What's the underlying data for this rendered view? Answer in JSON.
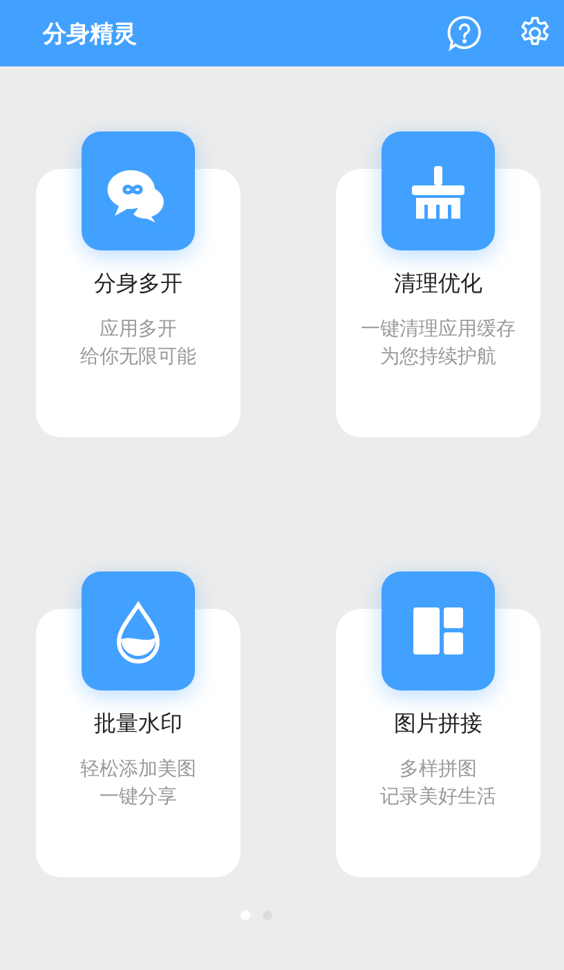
{
  "app_bar": {
    "title": "分身精灵"
  },
  "features": [
    {
      "kind": "clone",
      "title": "分身多开",
      "lines": [
        "应用多开",
        "给你无限可能"
      ]
    },
    {
      "kind": "clean",
      "title": "清理优化",
      "lines": [
        "一键清理应用缓存",
        "为您持续护航"
      ]
    },
    {
      "kind": "watermark",
      "title": "批量水印",
      "lines": [
        "轻松添加美图",
        "一键分享"
      ]
    },
    {
      "kind": "collage",
      "title": "图片拼接",
      "lines": [
        "多样拼图",
        "记录美好生活"
      ]
    }
  ],
  "page_dots": [
    {
      "selected": true
    },
    {
      "selected": false
    }
  ]
}
